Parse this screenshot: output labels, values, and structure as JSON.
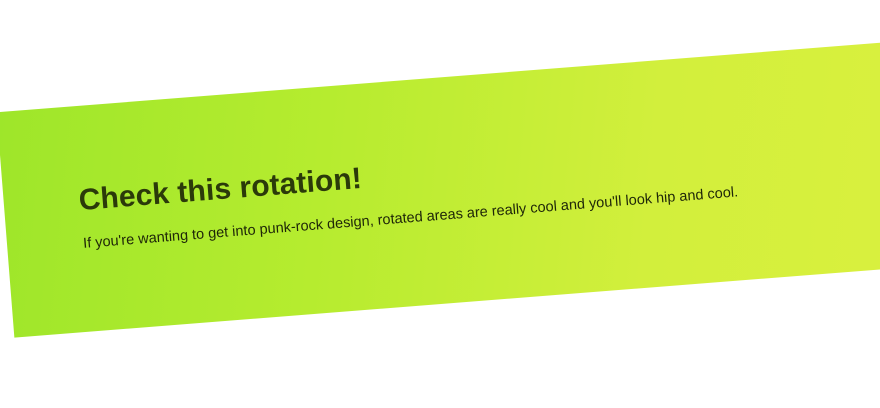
{
  "colors": {
    "background": "#ffffff",
    "panel_gradient_start": "#9ee62a",
    "panel_gradient_end": "#daf03e",
    "title": "#2b3a0a",
    "text": "#1e2608"
  },
  "panel": {
    "title": "Check this rotation!",
    "text": "If you're wanting to get into punk-rock design, rotated areas are really cool and you'll look hip and cool."
  }
}
